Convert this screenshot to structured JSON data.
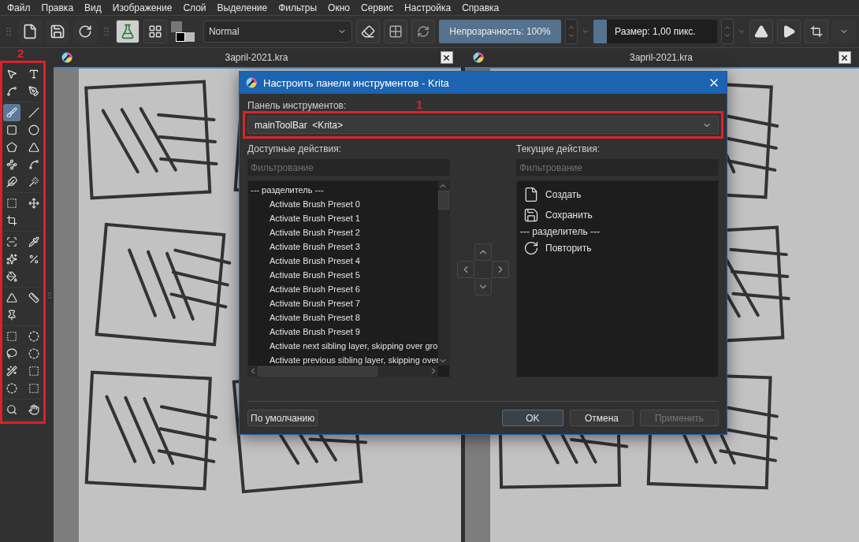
{
  "menu": [
    "Файл",
    "Правка",
    "Вид",
    "Изображение",
    "Слой",
    "Выделение",
    "Фильтры",
    "Окно",
    "Сервис",
    "Настройка",
    "Справка"
  ],
  "toolbar": {
    "blend_mode": "Normal",
    "opacity": {
      "label": "Непрозрачность: 100%",
      "level": 1
    },
    "size": {
      "label": "Размер: 1,00 пикс.",
      "level": 0.11
    }
  },
  "toolbox": {
    "annotation": "2",
    "tools": [
      {
        "selected": false
      },
      {
        "selected": false
      },
      {
        "selected": false
      },
      {
        "selected": false
      },
      {
        "selected": true
      },
      {
        "selected": false
      },
      {
        "selected": false
      },
      {
        "selected": false
      },
      {
        "selected": false
      },
      {
        "selected": false
      },
      {
        "selected": false
      },
      {
        "selected": false
      },
      {
        "selected": false
      },
      {
        "selected": false
      },
      {
        "selected": false
      },
      {
        "selected": false
      },
      {
        "selected": false
      },
      {
        "selected": false
      },
      {
        "selected": false
      },
      {
        "selected": false
      },
      {
        "selected": false
      },
      {
        "selected": false
      },
      {
        "selected": false
      },
      {
        "selected": false
      },
      {
        "selected": false
      },
      {
        "selected": false
      },
      {
        "selected": false
      },
      {
        "selected": false
      },
      {
        "selected": false
      },
      {
        "selected": false
      },
      {
        "selected": false
      },
      {
        "selected": false
      },
      {
        "selected": false
      },
      {
        "selected": false
      },
      {
        "selected": false
      }
    ]
  },
  "documents": [
    {
      "title": "3april-2021.kra"
    },
    {
      "title": "3april-2021.kra"
    }
  ],
  "dialog": {
    "title": "Настроить панели инструментов - Krita",
    "toolbar_label": "Панель инструментов:",
    "toolbar_select": {
      "value": "mainToolBar  <Krita>",
      "annotation": "1"
    },
    "available": {
      "label": "Доступные действия:",
      "filter_placeholder": "Фильтрование",
      "items": [
        {
          "kind": "separator",
          "label": "--- разделитель ---"
        },
        {
          "kind": "action",
          "label": "Activate Brush Preset 0"
        },
        {
          "kind": "action",
          "label": "Activate Brush Preset 1"
        },
        {
          "kind": "action",
          "label": "Activate Brush Preset 2"
        },
        {
          "kind": "action",
          "label": "Activate Brush Preset 3"
        },
        {
          "kind": "action",
          "label": "Activate Brush Preset 4"
        },
        {
          "kind": "action",
          "label": "Activate Brush Preset 5"
        },
        {
          "kind": "action",
          "label": "Activate Brush Preset 6"
        },
        {
          "kind": "action",
          "label": "Activate Brush Preset 7"
        },
        {
          "kind": "action",
          "label": "Activate Brush Preset 8"
        },
        {
          "kind": "action",
          "label": "Activate Brush Preset 9"
        },
        {
          "kind": "action",
          "label": "Activate next sibling layer, skipping over gro"
        },
        {
          "kind": "action",
          "label": "Activate previous sibling layer, skipping over"
        }
      ]
    },
    "current": {
      "label": "Текущие действия:",
      "filter_placeholder": "Фильтрование",
      "items": [
        {
          "kind": "action",
          "label": "Создать"
        },
        {
          "kind": "action",
          "label": "Сохранить"
        },
        {
          "kind": "separator",
          "label": "--- разделитель ---"
        },
        {
          "kind": "action",
          "label": "Повторить"
        }
      ]
    },
    "buttons": [
      {
        "label": "По умолчанию",
        "kind": "secondary",
        "disabled": false
      },
      {
        "label": "OK",
        "kind": "primary",
        "disabled": false
      },
      {
        "label": "Отмена",
        "kind": "normal",
        "disabled": false
      },
      {
        "label": "Применить",
        "kind": "normal",
        "disabled": true
      }
    ]
  }
}
